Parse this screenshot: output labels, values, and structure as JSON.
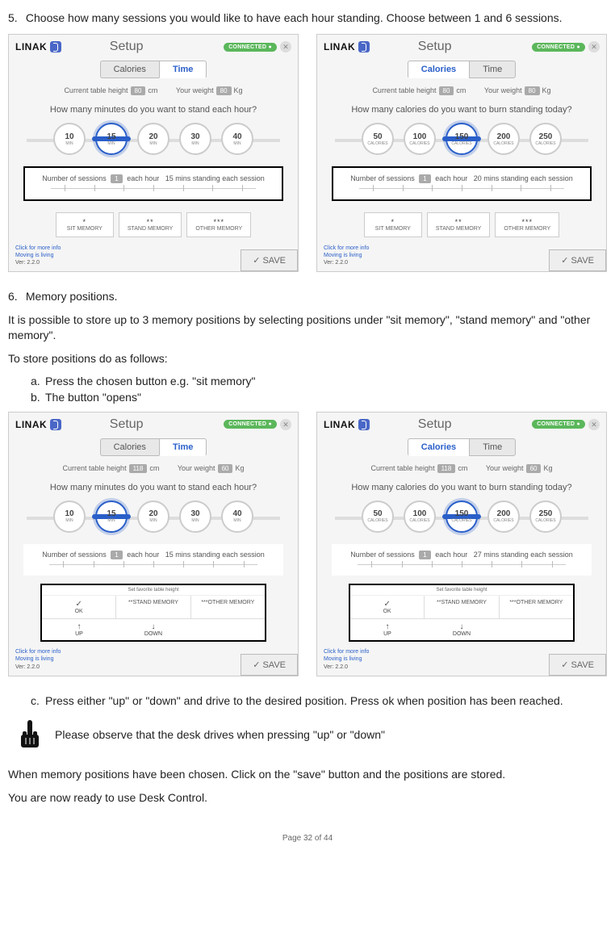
{
  "step5": {
    "num": "5.",
    "text": "Choose how many sessions you would like to have each hour standing. Choose between 1 and 6 sessions."
  },
  "step6": {
    "num": "6.",
    "title": "Memory positions.",
    "intro": "It is possible to store up to 3 memory positions by selecting positions under \"sit memory\", \"stand memory\" and \"other memory\".",
    "todo": "To store positions do as follows:",
    "a_let": "a.",
    "a_text": "Press the chosen button e.g. \"sit memory\"",
    "b_let": "b.",
    "b_text": "The button \"opens\"",
    "c_let": "c.",
    "c_text": "Press either \"up\" or \"down\" and drive to the desired position. Press ok when position has been reached."
  },
  "note": "Please observe that the desk drives when pressing \"up\" or \"down\"",
  "afterNote1": "When memory positions have been chosen. Click on the \"save\" button and the positions are stored.",
  "afterNote2": "You are now ready to use Desk Control.",
  "footer": "Page 32 of 44",
  "common": {
    "logo": "LINAK",
    "title": "Setup",
    "connected": "CONNECTED",
    "tab_cal": "Calories",
    "tab_time": "Time",
    "height_label": "Current table height",
    "height_unit": "cm",
    "weight_label": "Your weight",
    "weight_unit": "Kg",
    "sessions_prefix": "Number of sessions",
    "sessions_each": "each hour",
    "mem_sit": "SIT MEMORY",
    "mem_stand": "STAND MEMORY",
    "mem_other": "OTHER MEMORY",
    "info_link": "Click for more info",
    "info_tag": "Moving is living",
    "version": "Ver: 2.2.0",
    "save": "SAVE",
    "opt_min_unit": "MIN",
    "opt_cal_unit": "CALORIES",
    "fav_title": "Set favorite table height",
    "ok": "OK",
    "up": "UP",
    "down": "DOWN",
    "sess_val": "1"
  },
  "screens": {
    "a": {
      "active_tab": "time",
      "height": "80",
      "weight": "80",
      "question": "How many minutes do you want to stand each hour?",
      "options": [
        "10",
        "15",
        "20",
        "30",
        "40"
      ],
      "selected": "15",
      "session_note": "15 mins standing each session",
      "sess_boxed": true,
      "mem_open": false
    },
    "b": {
      "active_tab": "cal",
      "height": "80",
      "weight": "80",
      "question": "How many calories do you want to burn standing today?",
      "options": [
        "50",
        "100",
        "150",
        "200",
        "250"
      ],
      "selected": "150",
      "session_note": "20 mins standing each session",
      "sess_boxed": true,
      "mem_open": false
    },
    "c": {
      "active_tab": "time",
      "height": "118",
      "weight": "60",
      "question": "How many minutes do you want to stand each hour?",
      "options": [
        "10",
        "15",
        "20",
        "30",
        "40"
      ],
      "selected": "15",
      "session_note": "15 mins standing each session",
      "sess_boxed": false,
      "mem_open": true
    },
    "d": {
      "active_tab": "cal",
      "height": "118",
      "weight": "60",
      "question": "How many calories do you want to burn standing today?",
      "options": [
        "50",
        "100",
        "150",
        "200",
        "250"
      ],
      "selected": "150",
      "session_note": "27 mins standing each session",
      "sess_boxed": false,
      "mem_open": true
    }
  }
}
